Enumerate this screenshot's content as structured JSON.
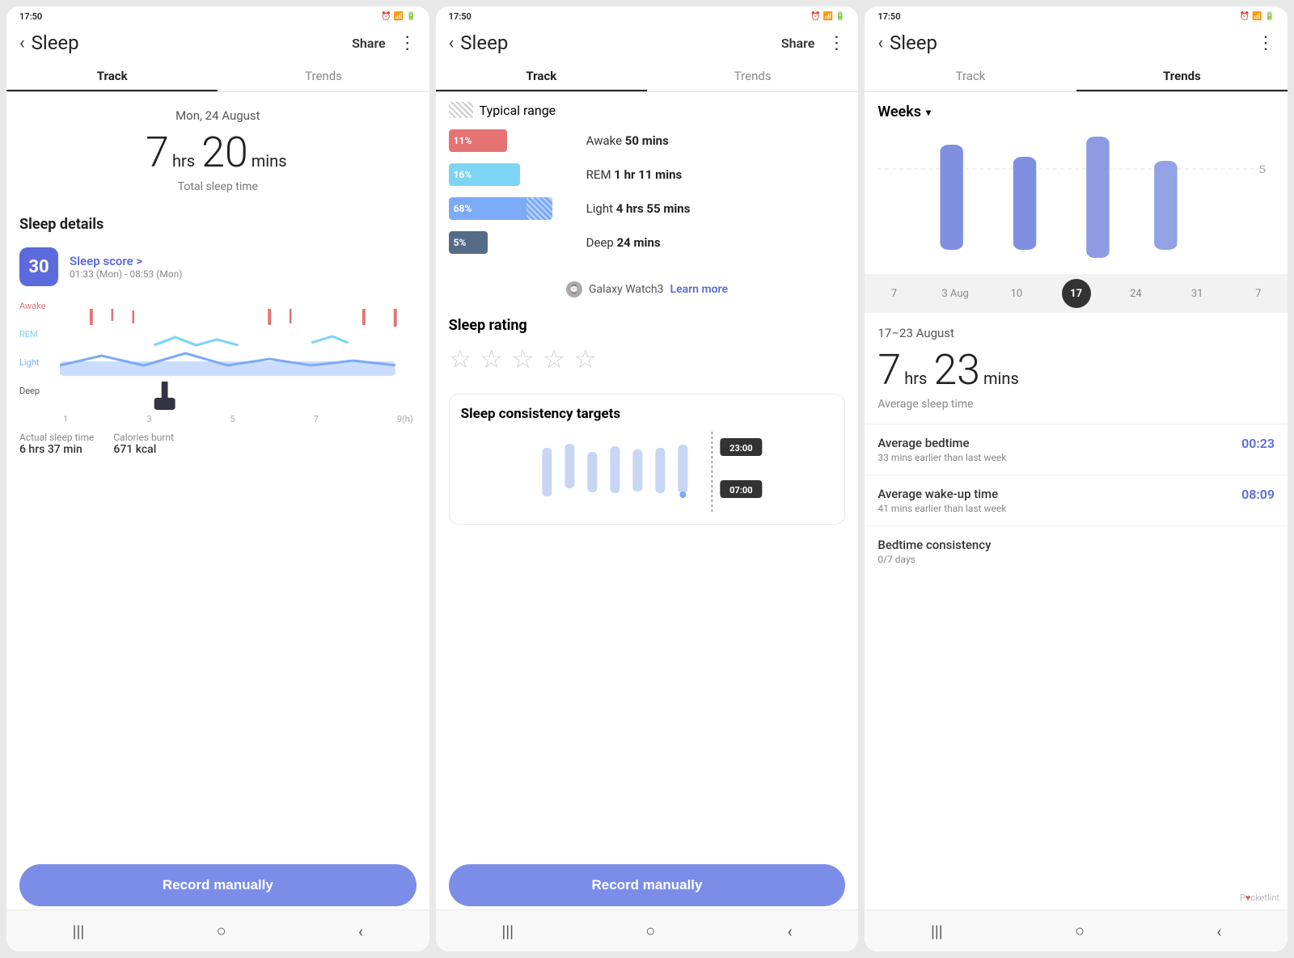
{
  "colors": {
    "accent": "#5b6bdd",
    "awake": "#e57373",
    "rem": "#7dd4f4",
    "light": "#7baaf7",
    "deep": "#334",
    "record_btn": "#7c8de8"
  },
  "screen1": {
    "status_time": "17:50",
    "title": "Sleep",
    "share": "Share",
    "tab_track": "Track",
    "tab_trends": "Trends",
    "date": "Mon, 24 August",
    "sleep_hrs": "7",
    "sleep_hrs_unit": "hrs",
    "sleep_mins": "20",
    "sleep_mins_unit": "mins",
    "total_label": "Total sleep time",
    "section_title": "Sleep details",
    "score": "30",
    "score_title": "Sleep score >",
    "score_sub": "01:33 (Mon) - 08:53 (Mon)",
    "chart_labels": [
      "Awake",
      "REM",
      "Light",
      "Deep"
    ],
    "chart_x": [
      "1",
      "3",
      "5",
      "7",
      "9(h)"
    ],
    "actual_label": "Actual sleep time",
    "actual_value": "6 hrs 37 min",
    "calories_label": "Calories burnt",
    "calories_value": "671 kcal",
    "record_btn": "Record manually"
  },
  "screen2": {
    "status_time": "17:50",
    "title": "Sleep",
    "share": "Share",
    "tab_track": "Track",
    "tab_trends": "Trends",
    "typical_label": "Typical range",
    "legend": [
      {
        "pct": "11%",
        "label": "Awake",
        "value": "50 mins",
        "color": "#e57373"
      },
      {
        "pct": "16%",
        "label": "REM",
        "value": "1 hr 11 mins",
        "color": "#7dd4f4"
      },
      {
        "pct": "68%",
        "label": "Light",
        "value": "4 hrs 55 mins",
        "color": "#7baaf7"
      },
      {
        "pct": "5%",
        "label": "Deep",
        "value": "24 mins",
        "color": "#556"
      }
    ],
    "device": "Galaxy Watch3",
    "learn_more": "Learn more",
    "rating_title": "Sleep rating",
    "stars": [
      "☆",
      "☆",
      "☆",
      "☆",
      "☆"
    ],
    "consistency_title": "Sleep consistency targets",
    "time_23": "23:00",
    "time_07": "07:00",
    "record_btn": "Record manually"
  },
  "screen3": {
    "status_time": "17:50",
    "title": "Sleep",
    "tab_track": "Track",
    "tab_trends": "Trends",
    "period": "Weeks",
    "x_labels": [
      "7",
      "3 Aug",
      "10",
      "17",
      "24",
      "31",
      "7"
    ],
    "active_label": "17",
    "week_range": "17–23 August",
    "avg_hrs": "7",
    "avg_hrs_unit": "hrs",
    "avg_mins": "23",
    "avg_mins_unit": "mins",
    "avg_label": "Average sleep time",
    "avg_bedtime_label": "Average bedtime",
    "avg_bedtime_value": "00:23",
    "avg_bedtime_sub": "33 mins earlier than last week",
    "avg_wake_label": "Average wake-up time",
    "avg_wake_value": "08:09",
    "avg_wake_sub": "41 mins earlier than last week",
    "bedtime_consistency_label": "Bedtime consistency",
    "bedtime_consistency_value": "0/7 days",
    "y_label": "5",
    "pocketlint": "Pocketlint"
  }
}
